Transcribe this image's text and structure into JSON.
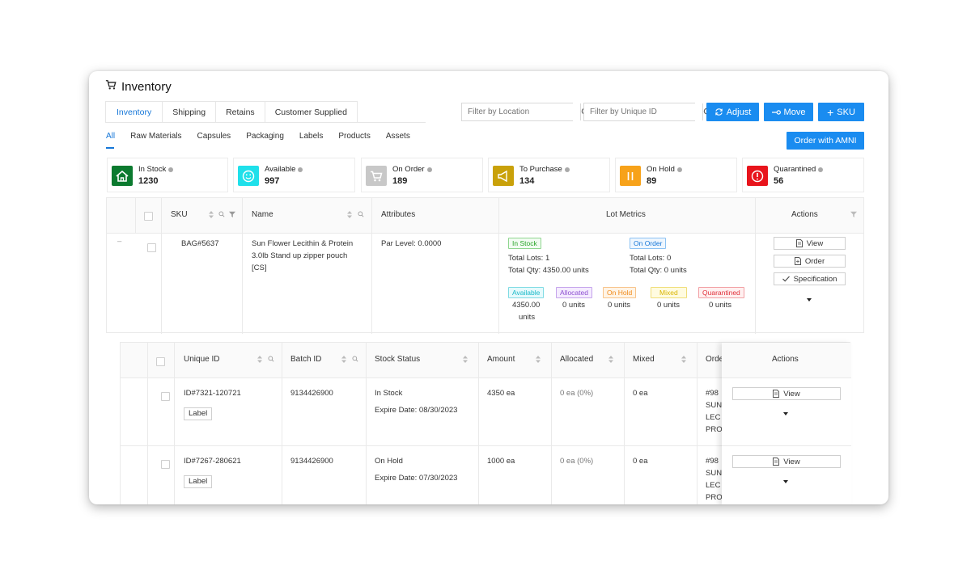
{
  "page": {
    "title": "Inventory"
  },
  "tabs": [
    {
      "label": "Inventory"
    },
    {
      "label": "Shipping"
    },
    {
      "label": "Retains"
    },
    {
      "label": "Customer Supplied"
    }
  ],
  "filters": {
    "location_placeholder": "Filter by Location",
    "unique_id_placeholder": "Filter by Unique ID"
  },
  "toolbar": {
    "adjust_label": "Adjust",
    "move_label": "Move",
    "sku_label": "SKU",
    "order_amni_label": "Order with AMNI"
  },
  "categories": [
    {
      "label": "All"
    },
    {
      "label": "Raw Materials"
    },
    {
      "label": "Capsules"
    },
    {
      "label": "Packaging"
    },
    {
      "label": "Labels"
    },
    {
      "label": "Products"
    },
    {
      "label": "Assets"
    }
  ],
  "stats": [
    {
      "label": "In Stock",
      "value": "1230",
      "color": "#0b7a2f",
      "icon": "house-icon"
    },
    {
      "label": "Available",
      "value": "997",
      "color": "#1fe0ea",
      "icon": "smile-icon"
    },
    {
      "label": "On Order",
      "value": "189",
      "color": "#c8c8c8",
      "icon": "cart-icon"
    },
    {
      "label": "To Purchase",
      "value": "134",
      "color": "#c9a10a",
      "icon": "megaphone-icon"
    },
    {
      "label": "On Hold",
      "value": "89",
      "color": "#f7a21a",
      "icon": "pause-icon"
    },
    {
      "label": "Quarantined",
      "value": "56",
      "color": "#e8141c",
      "icon": "alert-icon"
    }
  ],
  "main_table": {
    "headers": {
      "sku": "SKU",
      "name": "Name",
      "attributes": "Attributes",
      "lot_metrics": "Lot Metrics",
      "actions": "Actions"
    },
    "row": {
      "expand": "–",
      "sku": "BAG#5637",
      "name_lines": [
        "Sun Flower Lecithin & Protein",
        "3.0lb Stand up zipper pouch",
        "[CS]"
      ],
      "attribute": "Par Level:  0.0000",
      "in_stock": {
        "tag": "In Stock",
        "lots": "Total Lots:  1",
        "qty": "Total Qty:  4350.00 units"
      },
      "on_order": {
        "tag": "On Order",
        "lots": "Total Lots:  0",
        "qty": "Total Qty:  0 units"
      },
      "status_tags": [
        {
          "label": "Available",
          "value": "4350.00",
          "value2": "units",
          "color": "#18b8c8",
          "bg": "#e6fafc"
        },
        {
          "label": "Allocated",
          "value": "0 units",
          "value2": "",
          "color": "#8d4fd0",
          "bg": "#f5ecff"
        },
        {
          "label": "On Hold",
          "value": "0 units",
          "value2": "",
          "color": "#f08a1a",
          "bg": "#fff4e6"
        },
        {
          "label": "Mixed",
          "value": "0 units",
          "value2": "",
          "color": "#d9b400",
          "bg": "#fffbe0"
        },
        {
          "label": "Quarantined",
          "value": "0 units",
          "value2": "",
          "color": "#e0303a",
          "bg": "#fff0f0"
        }
      ],
      "actions": {
        "view": "View",
        "order": "Order",
        "specification": "Specification"
      }
    }
  },
  "lot_table": {
    "headers": {
      "unique_id": "Unique ID",
      "batch_id": "Batch ID",
      "stock_status": "Stock Status",
      "amount": "Amount",
      "allocated": "Allocated",
      "mixed": "Mixed",
      "order": "Orde",
      "actions": "Actions"
    },
    "rows": [
      {
        "unique_id": "ID#7321-120721",
        "label_btn": "Label",
        "batch_id": "9134426900",
        "status": "In Stock",
        "expire": "Expire Date: 08/30/2023",
        "amount": "4350 ea",
        "allocated": "0 ea (0%)",
        "mixed": "0 ea",
        "order_lines": [
          "#98",
          "SUN",
          "LEC",
          "PRO"
        ],
        "view": "View"
      },
      {
        "unique_id": "ID#7267-280621",
        "label_btn": "Label",
        "batch_id": "9134426900",
        "status": "On Hold",
        "expire": "Expire Date: 07/30/2023",
        "amount": "1000 ea",
        "allocated": "0 ea (0%)",
        "mixed": "0 ea",
        "order_lines": [
          "#98",
          "SUN",
          "LEC",
          "PRO"
        ],
        "view": "View"
      }
    ]
  }
}
